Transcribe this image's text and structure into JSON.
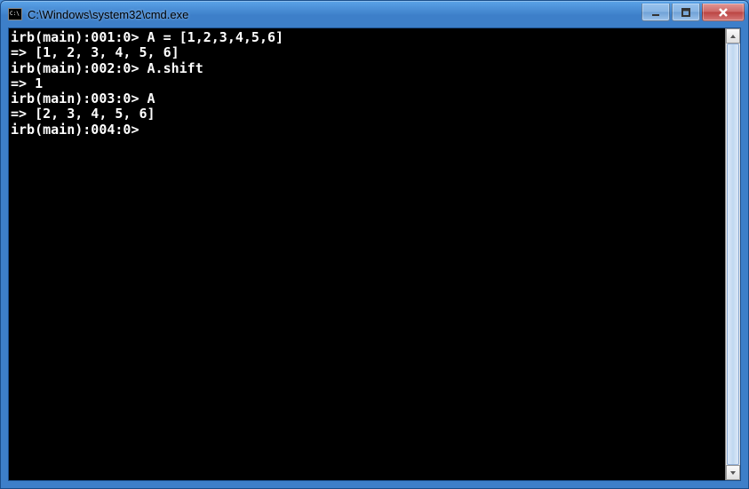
{
  "window": {
    "title": "C:\\Windows\\system32\\cmd.exe"
  },
  "terminal": {
    "lines": [
      "irb(main):001:0> A = [1,2,3,4,5,6]",
      "=> [1, 2, 3, 4, 5, 6]",
      "irb(main):002:0> A.shift",
      "=> 1",
      "irb(main):003:0> A",
      "=> [2, 3, 4, 5, 6]",
      "irb(main):004:0>"
    ]
  }
}
